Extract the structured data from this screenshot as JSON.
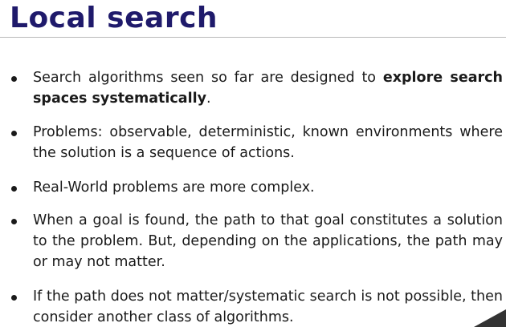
{
  "slide": {
    "title": "Local search",
    "bullets": [
      {
        "text": "Search algorithms seen so far are designed to ",
        "bold": "explore search spaces systematically",
        "after": "."
      },
      {
        "text": "Problems:  observable, deterministic, known environments where the solution is a sequence of actions."
      },
      {
        "text": "Real-World problems are more complex."
      },
      {
        "text": "When a goal is found, the path to that goal constitutes a solution to the problem. But, depending on the applications, the path may or may not matter."
      },
      {
        "text": "If the path does not matter/systematic search is not possible, then consider another class of algorithms."
      }
    ]
  },
  "colors": {
    "title": "#1f1a6b",
    "text": "#1a1a1a",
    "rule": "#b8b8b8"
  }
}
